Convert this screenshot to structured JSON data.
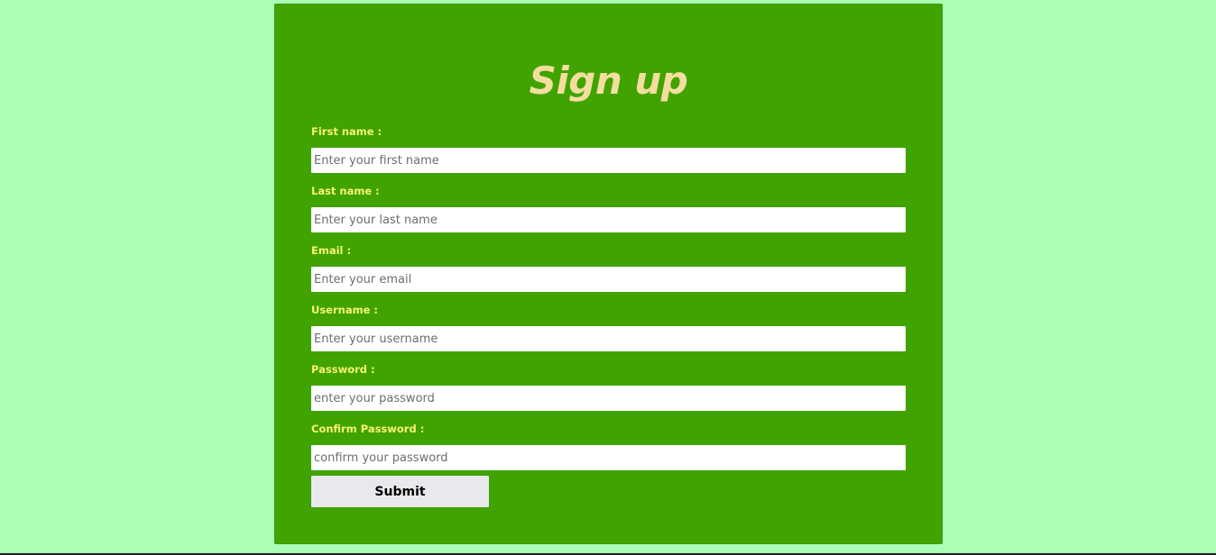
{
  "form": {
    "title": "Sign up",
    "fields": [
      {
        "label": "First name :",
        "placeholder": "Enter your first name",
        "type": "text"
      },
      {
        "label": "Last name :",
        "placeholder": "Enter your last name",
        "type": "text"
      },
      {
        "label": "Email :",
        "placeholder": "Enter your email",
        "type": "email"
      },
      {
        "label": "Username :",
        "placeholder": "Enter your username",
        "type": "text"
      },
      {
        "label": "Password :",
        "placeholder": "enter your password",
        "type": "password"
      },
      {
        "label": "Confirm Password :",
        "placeholder": "confirm your password",
        "type": "password"
      }
    ],
    "submit_label": "Submit"
  },
  "colors": {
    "page_background": "#aaffb4",
    "card_background": "#41a300",
    "title": "#f3de9f",
    "label": "#f7f37a",
    "button_background": "#e9e9ed"
  }
}
